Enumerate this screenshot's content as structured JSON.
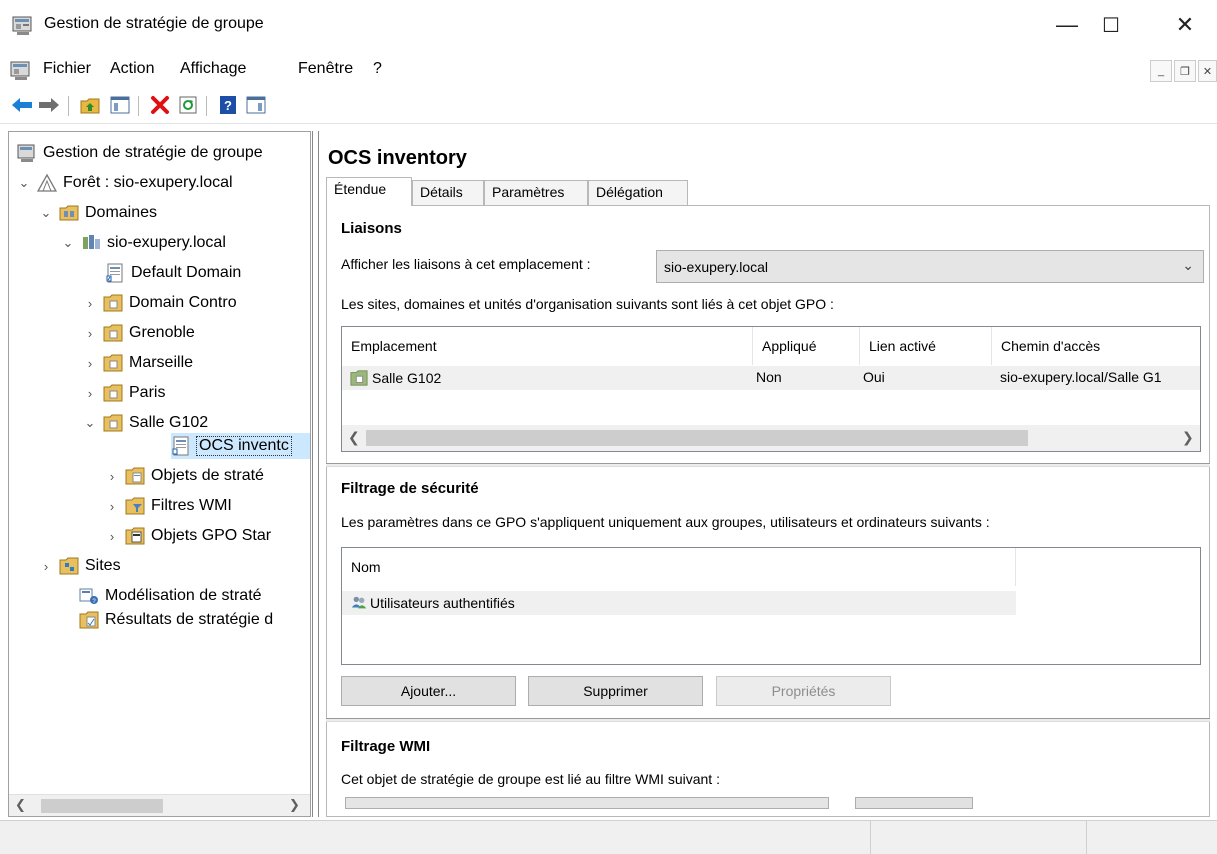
{
  "window": {
    "title": "Gestion de stratégie de groupe",
    "controls": {
      "minimize": "—",
      "maximize": "☐",
      "close": "✕"
    }
  },
  "menu": {
    "items": [
      "Fichier",
      "Action",
      "Affichage",
      "Fenêtre",
      "?"
    ]
  },
  "toolbar": {
    "buttons": [
      "back-arrow-icon",
      "forward-arrow-icon",
      "up-folder-icon",
      "show-hide-tree-icon",
      "delete-icon",
      "refresh-icon",
      "help-icon",
      "properties-pane-icon"
    ]
  },
  "tree": {
    "root": "Gestion de stratégie de groupe",
    "forest": "Forêt : sio-exupery.local",
    "domains": "Domaines",
    "domain": "sio-exupery.local",
    "items": [
      {
        "label": "Default Domain",
        "icon": "gpo-link-icon"
      },
      {
        "label": "Domain Contro",
        "icon": "ou-folder-icon"
      },
      {
        "label": "Grenoble",
        "icon": "ou-folder-icon"
      },
      {
        "label": "Marseille",
        "icon": "ou-folder-icon"
      },
      {
        "label": "Paris",
        "icon": "ou-folder-icon"
      },
      {
        "label": "Salle G102",
        "icon": "ou-folder-icon"
      }
    ],
    "selected": "OCS inventc",
    "domain_children": [
      "Objets de straté",
      "Filtres WMI",
      "Objets GPO Star"
    ],
    "sites": "Sites",
    "modeling": "Modélisation de straté",
    "results": "Résultats de stratégie d"
  },
  "gpo": {
    "title": "OCS inventory",
    "tabs": [
      "Étendue",
      "Détails",
      "Paramètres",
      "Délégation"
    ],
    "active_tab": "Étendue"
  },
  "links": {
    "section_title": "Liaisons",
    "display_label": "Afficher les liaisons à cet emplacement :",
    "location_value": "sio-exupery.local",
    "description": "Les sites, domaines et unités d'organisation suivants sont liés à cet objet GPO :",
    "columns": [
      "Emplacement",
      "Appliqué",
      "Lien activé",
      "Chemin d'accès"
    ],
    "rows": [
      {
        "location": "Salle G102",
        "enforced": "Non",
        "enabled": "Oui",
        "path": "sio-exupery.local/Salle G1"
      }
    ]
  },
  "security": {
    "section_title": "Filtrage de sécurité",
    "description": "Les paramètres dans ce GPO s'appliquent uniquement aux groupes, utilisateurs et ordinateurs suivants :",
    "column": "Nom",
    "rows": [
      "Utilisateurs authentifiés"
    ],
    "buttons": {
      "add": "Ajouter...",
      "remove": "Supprimer",
      "properties": "Propriétés"
    }
  },
  "wmi": {
    "section_title": "Filtrage WMI",
    "description": "Cet objet de stratégie de groupe est lié au filtre WMI suivant :"
  },
  "colors": {
    "selection": "#cce8ff",
    "tab_border": "#b8b8b8",
    "button_face": "#e1e1e1"
  }
}
